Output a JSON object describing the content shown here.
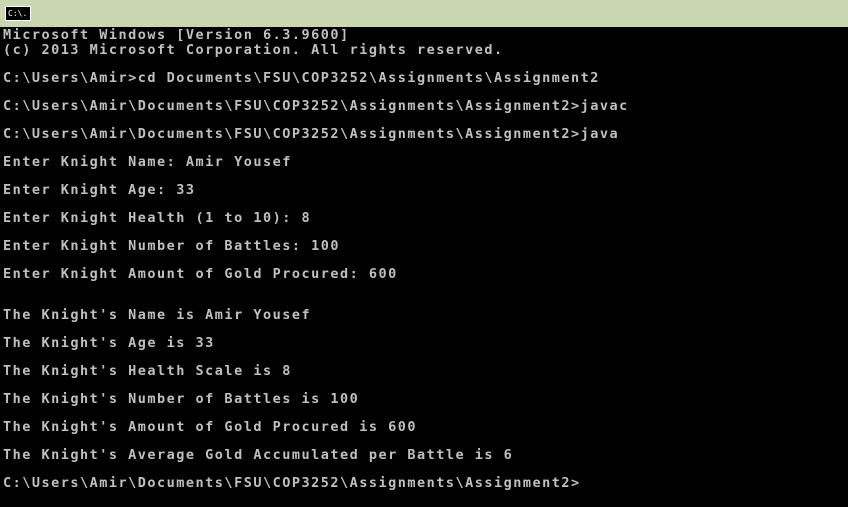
{
  "titlebar": {
    "icon_text": "C:\\.",
    "icon_name": "cmd-icon",
    "background": "#c8d7b2"
  },
  "console": {
    "text_color": "#c0c0c0",
    "background": "#000000",
    "lines": [
      "Microsoft Windows [Version 6.3.9600]",
      "(c) 2013 Microsoft Corporation. All rights reserved.",
      "C:\\Users\\Amir>cd Documents\\FSU\\COP3252\\Assignments\\Assignment2",
      "C:\\Users\\Amir\\Documents\\FSU\\COP3252\\Assignments\\Assignment2>javac",
      "C:\\Users\\Amir\\Documents\\FSU\\COP3252\\Assignments\\Assignment2>java",
      "Enter Knight Name: Amir Yousef",
      "Enter Knight Age: 33",
      "Enter Knight Health (1 to 10): 8",
      "Enter Knight Number of Battles: 100",
      "Enter Knight Amount of Gold Procured: 600",
      "The Knight's Name is Amir Yousef",
      "The Knight's Age is 33",
      "The Knight's Health Scale is 8",
      "The Knight's Number of Battles is 100",
      "The Knight's Amount of Gold Procured is 600",
      "The Knight's Average Gold Accumulated per Battle is 6",
      "C:\\Users\\Amir\\Documents\\FSU\\COP3252\\Assignments\\Assignment2>"
    ]
  }
}
